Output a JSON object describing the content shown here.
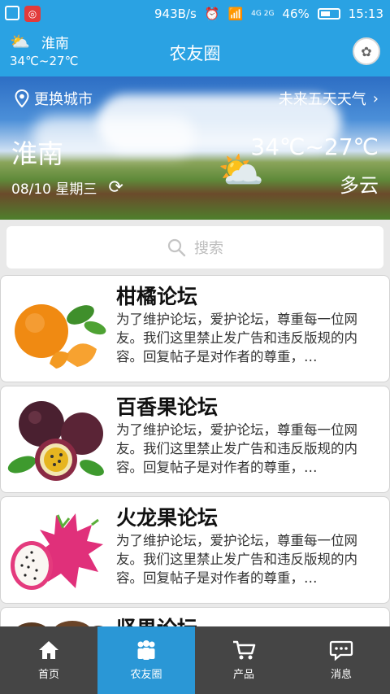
{
  "statusbar": {
    "net_speed": "943B/s",
    "battery": "46%",
    "time": "15:13",
    "signal": "4G 2G"
  },
  "appbar": {
    "city": "淮南",
    "temp_range": "34℃~27℃",
    "title": "农友圈"
  },
  "banner": {
    "change_city": "更换城市",
    "forecast_link": "未来五天天气",
    "city": "淮南",
    "date": "08/10 星期三",
    "temp_range": "34℃~27℃",
    "condition": "多云"
  },
  "search": {
    "placeholder": "搜索"
  },
  "forums": [
    {
      "title": "柑橘论坛",
      "desc": "为了维护论坛，爱护论坛，尊重每一位网友。我们这里禁止发广告和违反版规的内容。回复帖子是对作者的尊重，…",
      "image": "orange"
    },
    {
      "title": "百香果论坛",
      "desc": "为了维护论坛，爱护论坛，尊重每一位网友。我们这里禁止发广告和违反版规的内容。回复帖子是对作者的尊重，…",
      "image": "passion-fruit"
    },
    {
      "title": "火龙果论坛",
      "desc": "为了维护论坛，爱护论坛，尊重每一位网友。我们这里禁止发广告和违反版规的内容。回复帖子是对作者的尊重，…",
      "image": "dragon-fruit"
    },
    {
      "title": "坚果论坛",
      "desc": "",
      "image": "nuts"
    }
  ],
  "tabs": [
    {
      "label": "首页",
      "icon": "home-icon",
      "active": false
    },
    {
      "label": "农友圈",
      "icon": "people-icon",
      "active": true
    },
    {
      "label": "产品",
      "icon": "cart-icon",
      "active": false
    },
    {
      "label": "消息",
      "icon": "message-icon",
      "active": false
    }
  ],
  "colors": {
    "primary": "#2aa2e3",
    "tab_active": "#2a97d6",
    "tabbar": "#454545"
  }
}
